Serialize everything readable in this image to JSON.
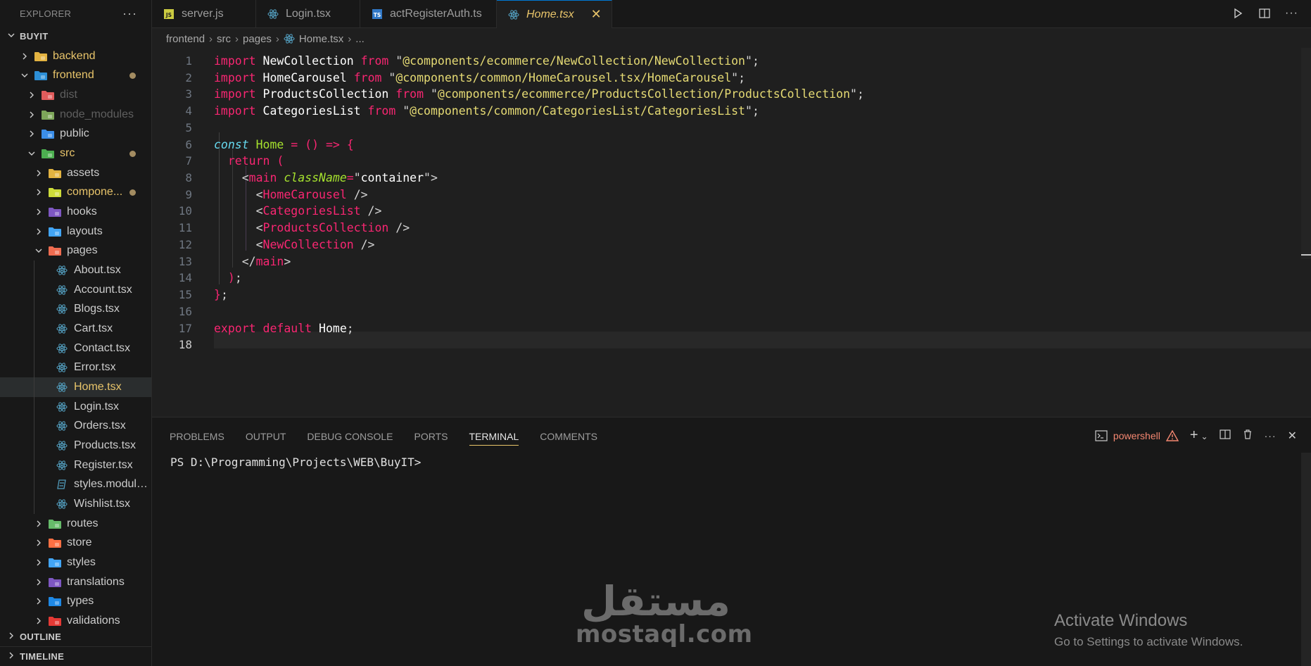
{
  "explorer": {
    "title": "EXPLORER",
    "more": "···",
    "workspace": "BUYIT",
    "tree": [
      {
        "label": "backend",
        "depth": 0,
        "type": "folder",
        "expanded": false,
        "icon": "folder-backend",
        "color": "#e8c46a"
      },
      {
        "label": "frontend",
        "depth": 0,
        "type": "folder",
        "expanded": true,
        "icon": "folder-frontend",
        "color": "#e8c46a",
        "modified": true
      },
      {
        "label": "dist",
        "depth": 1,
        "type": "folder",
        "expanded": false,
        "icon": "folder-dist",
        "color": "#5f5f5f",
        "dimmed": true
      },
      {
        "label": "node_modules",
        "depth": 1,
        "type": "folder",
        "expanded": false,
        "icon": "folder-node",
        "color": "#5f5f5f",
        "dimmed": true
      },
      {
        "label": "public",
        "depth": 1,
        "type": "folder",
        "expanded": false,
        "icon": "folder-public",
        "color": "#cccccc"
      },
      {
        "label": "src",
        "depth": 1,
        "type": "folder",
        "expanded": true,
        "icon": "folder-src",
        "color": "#e8c46a",
        "modified": true
      },
      {
        "label": "assets",
        "depth": 2,
        "type": "folder",
        "expanded": false,
        "icon": "folder-assets",
        "color": "#cccccc"
      },
      {
        "label": "compone...",
        "depth": 2,
        "type": "folder",
        "expanded": false,
        "icon": "folder-components",
        "color": "#e8c46a",
        "modified": true
      },
      {
        "label": "hooks",
        "depth": 2,
        "type": "folder",
        "expanded": false,
        "icon": "folder-hooks",
        "color": "#cccccc"
      },
      {
        "label": "layouts",
        "depth": 2,
        "type": "folder",
        "expanded": false,
        "icon": "folder-layouts",
        "color": "#cccccc"
      },
      {
        "label": "pages",
        "depth": 2,
        "type": "folder",
        "expanded": true,
        "icon": "folder-pages",
        "color": "#cccccc"
      },
      {
        "label": "About.tsx",
        "depth": 3,
        "type": "file",
        "icon": "react-icon",
        "color": "#cccccc"
      },
      {
        "label": "Account.tsx",
        "depth": 3,
        "type": "file",
        "icon": "react-icon",
        "color": "#cccccc"
      },
      {
        "label": "Blogs.tsx",
        "depth": 3,
        "type": "file",
        "icon": "react-icon",
        "color": "#cccccc"
      },
      {
        "label": "Cart.tsx",
        "depth": 3,
        "type": "file",
        "icon": "react-icon",
        "color": "#cccccc"
      },
      {
        "label": "Contact.tsx",
        "depth": 3,
        "type": "file",
        "icon": "react-icon",
        "color": "#cccccc"
      },
      {
        "label": "Error.tsx",
        "depth": 3,
        "type": "file",
        "icon": "react-icon",
        "color": "#cccccc"
      },
      {
        "label": "Home.tsx",
        "depth": 3,
        "type": "file",
        "icon": "react-icon",
        "color": "#e8c46a",
        "active": true
      },
      {
        "label": "Login.tsx",
        "depth": 3,
        "type": "file",
        "icon": "react-icon",
        "color": "#cccccc"
      },
      {
        "label": "Orders.tsx",
        "depth": 3,
        "type": "file",
        "icon": "react-icon",
        "color": "#cccccc"
      },
      {
        "label": "Products.tsx",
        "depth": 3,
        "type": "file",
        "icon": "react-icon",
        "color": "#cccccc"
      },
      {
        "label": "Register.tsx",
        "depth": 3,
        "type": "file",
        "icon": "react-icon",
        "color": "#cccccc"
      },
      {
        "label": "styles.module....",
        "depth": 3,
        "type": "file",
        "icon": "css-icon",
        "color": "#cccccc"
      },
      {
        "label": "Wishlist.tsx",
        "depth": 3,
        "type": "file",
        "icon": "react-icon",
        "color": "#cccccc"
      },
      {
        "label": "routes",
        "depth": 2,
        "type": "folder",
        "expanded": false,
        "icon": "folder-routes",
        "color": "#cccccc"
      },
      {
        "label": "store",
        "depth": 2,
        "type": "folder",
        "expanded": false,
        "icon": "folder-store",
        "color": "#cccccc"
      },
      {
        "label": "styles",
        "depth": 2,
        "type": "folder",
        "expanded": false,
        "icon": "folder-styles",
        "color": "#cccccc"
      },
      {
        "label": "translations",
        "depth": 2,
        "type": "folder",
        "expanded": false,
        "icon": "folder-translations",
        "color": "#cccccc"
      },
      {
        "label": "types",
        "depth": 2,
        "type": "folder",
        "expanded": false,
        "icon": "folder-types",
        "color": "#cccccc"
      },
      {
        "label": "validations",
        "depth": 2,
        "type": "folder",
        "expanded": false,
        "icon": "folder-validations",
        "color": "#cccccc"
      }
    ],
    "outline": "OUTLINE",
    "timeline": "TIMELINE"
  },
  "tabs": [
    {
      "label": "server.js",
      "icon": "js-file-icon",
      "active": false
    },
    {
      "label": "Login.tsx",
      "icon": "react-icon",
      "active": false
    },
    {
      "label": "actRegisterAuth.ts",
      "icon": "ts-file-icon",
      "active": false
    },
    {
      "label": "Home.tsx",
      "icon": "react-icon",
      "active": true
    }
  ],
  "tab_close": "✕",
  "breadcrumb": [
    "frontend",
    "src",
    "pages",
    "Home.tsx",
    "..."
  ],
  "editor": {
    "current_line": 18,
    "lines": [
      [
        [
          "import ",
          "kw"
        ],
        [
          "NewCollection",
          "ident"
        ],
        [
          " from ",
          "kw"
        ],
        [
          "\"",
          "strq"
        ],
        [
          "@components/ecommerce/NewCollection/NewCollection",
          "str"
        ],
        [
          "\"",
          "strq"
        ],
        [
          ";",
          "punc"
        ]
      ],
      [
        [
          "import ",
          "kw"
        ],
        [
          "HomeCarousel",
          "ident"
        ],
        [
          " from ",
          "kw"
        ],
        [
          "\"",
          "strq"
        ],
        [
          "@components/common/HomeCarousel.tsx/HomeCarousel",
          "str"
        ],
        [
          "\"",
          "strq"
        ],
        [
          ";",
          "punc"
        ]
      ],
      [
        [
          "import ",
          "kw"
        ],
        [
          "ProductsCollection",
          "ident"
        ],
        [
          " from ",
          "kw"
        ],
        [
          "\"",
          "strq"
        ],
        [
          "@components/ecommerce/ProductsCollection/ProductsCollection",
          "str"
        ],
        [
          "\"",
          "strq"
        ],
        [
          ";",
          "punc"
        ]
      ],
      [
        [
          "import ",
          "kw"
        ],
        [
          "CategoriesList",
          "ident"
        ],
        [
          " from ",
          "kw"
        ],
        [
          "\"",
          "strq"
        ],
        [
          "@components/common/CategoriesList/CategoriesList",
          "str"
        ],
        [
          "\"",
          "strq"
        ],
        [
          ";",
          "punc"
        ]
      ],
      [],
      [
        [
          "const ",
          "storage"
        ],
        [
          "Home",
          "fn"
        ],
        [
          " = ",
          "kw"
        ],
        [
          "() ",
          "kw"
        ],
        [
          "=> ",
          "kw"
        ],
        [
          "{",
          "kw"
        ]
      ],
      [
        [
          "  return ",
          "kw"
        ],
        [
          "(",
          "kw"
        ]
      ],
      [
        [
          "    <",
          "punc"
        ],
        [
          "main ",
          "tag"
        ],
        [
          "className",
          "attr"
        ],
        [
          "=",
          "kw"
        ],
        [
          "\"",
          "strq"
        ],
        [
          "container",
          "ident"
        ],
        [
          "\"",
          "strq"
        ],
        [
          ">",
          "punc"
        ]
      ],
      [
        [
          "      <",
          "punc"
        ],
        [
          "HomeCarousel",
          "tag"
        ],
        [
          " />",
          "punc"
        ]
      ],
      [
        [
          "      <",
          "punc"
        ],
        [
          "CategoriesList",
          "tag"
        ],
        [
          " />",
          "punc"
        ]
      ],
      [
        [
          "      <",
          "punc"
        ],
        [
          "ProductsCollection",
          "tag"
        ],
        [
          " />",
          "punc"
        ]
      ],
      [
        [
          "      <",
          "punc"
        ],
        [
          "NewCollection",
          "tag"
        ],
        [
          " />",
          "punc"
        ]
      ],
      [
        [
          "    </",
          "punc"
        ],
        [
          "main",
          "tag"
        ],
        [
          ">",
          "punc"
        ]
      ],
      [
        [
          "  )",
          "kw"
        ],
        [
          ";",
          "punc"
        ]
      ],
      [
        [
          "}",
          "kw"
        ],
        [
          ";",
          "punc"
        ]
      ],
      [],
      [
        [
          "export ",
          "kw"
        ],
        [
          "default ",
          "kw"
        ],
        [
          "Home",
          "ident"
        ],
        [
          ";",
          "punc"
        ]
      ],
      []
    ]
  },
  "panel": {
    "tabs": [
      "PROBLEMS",
      "OUTPUT",
      "DEBUG CONSOLE",
      "PORTS",
      "TERMINAL",
      "COMMENTS"
    ],
    "active_tab": "TERMINAL",
    "shell": "powershell",
    "prompt": "PS D:\\Programming\\Projects\\WEB\\BuyIT>"
  },
  "watermark": {
    "arabic": "مستقل",
    "latin": "mostaql.com"
  },
  "activation": {
    "title": "Activate Windows",
    "subtitle": "Go to Settings to activate Windows."
  },
  "colors": {
    "accent": "#e8c46a",
    "modified_dot": "#a38c61",
    "error": "#f48771"
  }
}
